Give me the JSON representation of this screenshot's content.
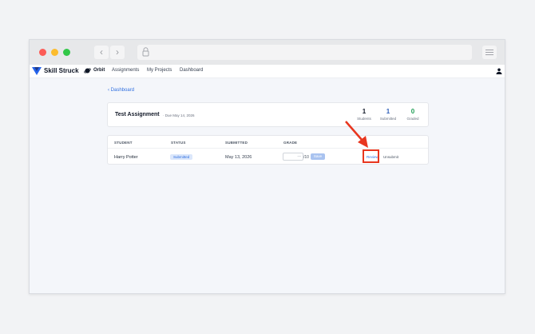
{
  "browser": {
    "controls": [
      "close",
      "minimize",
      "maximize"
    ],
    "nav_back_icon": "chevron-left-icon",
    "nav_forward_icon": "chevron-right-icon",
    "address_icon": "lock-icon",
    "menu_icon": "menu-icon"
  },
  "nav": {
    "brand": "Skill Struck",
    "product": "Orbit",
    "links": [
      "Assignments",
      "My Projects",
      "Dashboard"
    ],
    "user_icon": "user-icon"
  },
  "breadcrumb": {
    "label": "Dashboard"
  },
  "assignment": {
    "title": "Test Assignment",
    "due": "· Due May 14, 2026",
    "stats": [
      {
        "value": "1",
        "label": "Students",
        "color": "#111827"
      },
      {
        "value": "1",
        "label": "Submitted",
        "color": "#2f5fb8"
      },
      {
        "value": "0",
        "label": "Graded",
        "color": "#1f9d55"
      }
    ]
  },
  "table": {
    "headers": [
      "STUDENT",
      "STATUS",
      "SUBMITTED",
      "GRADE"
    ],
    "rows": [
      {
        "student": "Harry Potter",
        "status": "Submitted",
        "submitted": "May 13, 2026",
        "grade_placeholder": "—",
        "grade_max": "/10",
        "save_label": "Save",
        "review_label": "Review",
        "unsubmit_label": "Unsubmit"
      }
    ]
  },
  "colors": {
    "accent": "#2f6fe0",
    "highlight": "#e8361f"
  }
}
